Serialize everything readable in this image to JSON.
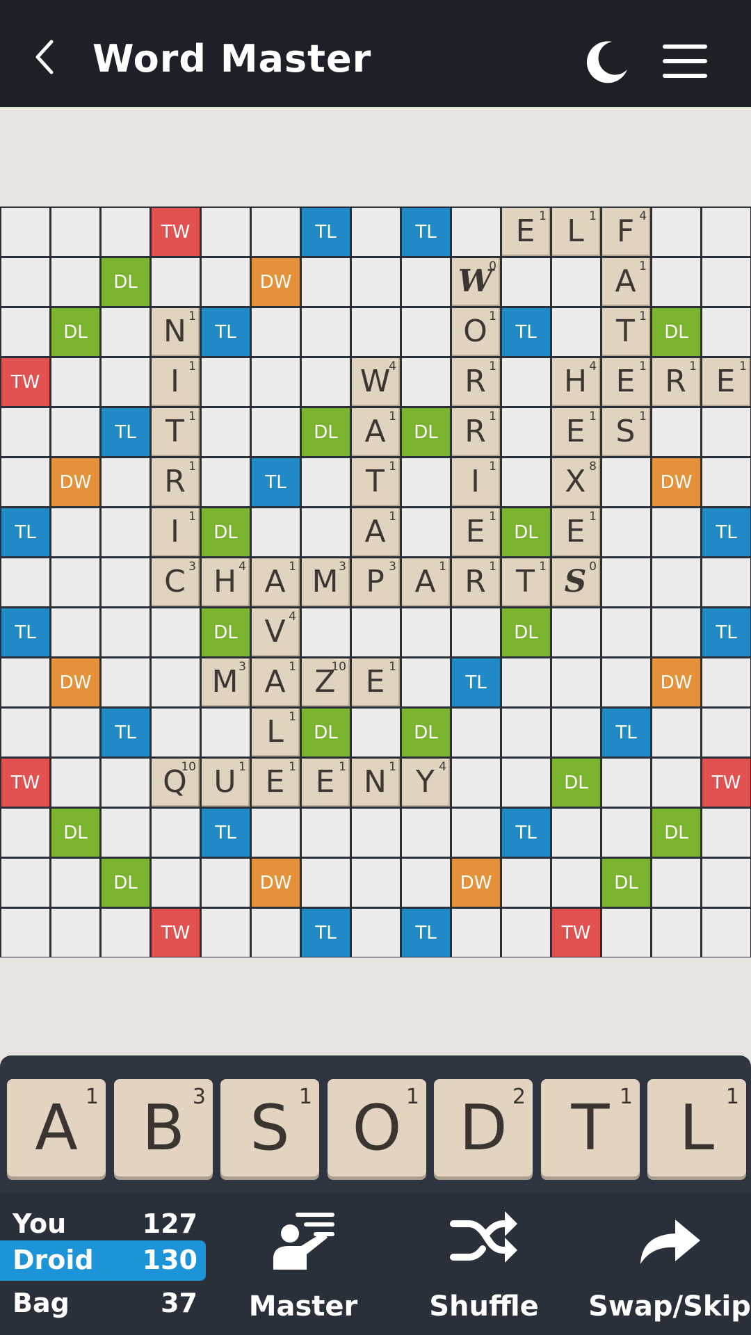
{
  "app": {
    "title": "Word Master"
  },
  "colors": {
    "tw": "#e0514f",
    "dw": "#e4923a",
    "dl": "#7ab32e",
    "tl": "#1f8ac6",
    "tile": "#e0d4c1",
    "active": "#1d93d8"
  },
  "icons": {
    "back": "chevron-left-icon",
    "theme": "moon-icon",
    "menu": "hamburger-menu-icon",
    "master": "master-icon",
    "shuffle": "shuffle-icon",
    "swap": "swap-arrow-icon"
  },
  "premium_labels": {
    "tw": "TW",
    "dw": "DW",
    "dl": "DL",
    "tl": "TL"
  },
  "board": {
    "rows": [
      "...T..t.t..EL F..",
      "..d..D...W...A..",
      ".d.N t....O t.Td.",
      "T..I...W.R.HERE",
      "..tT..dAdR.ES..",
      ".D.R.t.T.I.X..D.",
      "t..Id..A.Ed E..t",
      "...CHAMPARTS...",
      "t...dV....d...t",
      ".D..MAZE..t...D.",
      "..t..LdDd..t...",
      "T..QUEENY..d..T",
      ".d..t....t..d.",
      "..d..D...D..d..",
      "...T..t.t..T..."
    ],
    "premiums": [
      [
        "",
        "",
        "",
        "TW",
        "",
        "",
        "TL",
        "",
        "TL",
        "",
        "",
        "",
        "",
        "",
        ""
      ],
      [
        "",
        "",
        "DL",
        "",
        "",
        "DW",
        "",
        "",
        "",
        "",
        "",
        "",
        "",
        "",
        ""
      ],
      [
        "",
        "DL",
        "",
        "",
        "TL",
        "",
        "",
        "",
        "",
        "",
        "TL",
        "",
        "",
        "DL",
        ""
      ],
      [
        "TW",
        "",
        "",
        "",
        "",
        "",
        "",
        "",
        "",
        "",
        "",
        "",
        "",
        "",
        ""
      ],
      [
        "",
        "",
        "TL",
        "",
        "",
        "",
        "DL",
        "",
        "DL",
        "",
        "",
        "",
        "",
        "",
        ""
      ],
      [
        "",
        "DW",
        "",
        "",
        "",
        "TL",
        "",
        "",
        "",
        "",
        "",
        "",
        "",
        "DW",
        ""
      ],
      [
        "TL",
        "",
        "",
        "",
        "DL",
        "",
        "",
        "",
        "",
        "",
        "DL",
        "",
        "",
        "",
        "TL"
      ],
      [
        "",
        "",
        "",
        "",
        "",
        "",
        "",
        "",
        "",
        "",
        "",
        "",
        "",
        "",
        ""
      ],
      [
        "TL",
        "",
        "",
        "",
        "DL",
        "",
        "",
        "",
        "",
        "",
        "DL",
        "",
        "",
        "",
        "TL"
      ],
      [
        "",
        "DW",
        "",
        "",
        "",
        "",
        "",
        "",
        "",
        "TL",
        "",
        "",
        "",
        "DW",
        ""
      ],
      [
        "",
        "",
        "TL",
        "",
        "",
        "",
        "DL",
        "",
        "DL",
        "",
        "",
        "",
        "TL",
        "",
        ""
      ],
      [
        "TW",
        "",
        "",
        "",
        "",
        "",
        "",
        "",
        "",
        "",
        "",
        "DL",
        "",
        "",
        "TW"
      ],
      [
        "",
        "DL",
        "",
        "",
        "TL",
        "",
        "",
        "",
        "",
        "",
        "TL",
        "",
        "",
        "DL",
        ""
      ],
      [
        "",
        "",
        "DL",
        "",
        "",
        "DW",
        "",
        "",
        "",
        "DW",
        "",
        "",
        "DL",
        "",
        ""
      ],
      [
        "",
        "",
        "",
        "TW",
        "",
        "",
        "TL",
        "",
        "TL",
        "",
        "",
        "TW",
        "",
        "",
        ""
      ]
    ],
    "tiles": [
      {
        "r": 0,
        "c": 10,
        "letter": "E",
        "pts": "1"
      },
      {
        "r": 0,
        "c": 11,
        "letter": "L",
        "pts": "1"
      },
      {
        "r": 0,
        "c": 12,
        "letter": "F",
        "pts": "4"
      },
      {
        "r": 1,
        "c": 9,
        "letter": "W",
        "pts": "0",
        "blank": true
      },
      {
        "r": 1,
        "c": 12,
        "letter": "A",
        "pts": "1"
      },
      {
        "r": 2,
        "c": 3,
        "letter": "N",
        "pts": "1"
      },
      {
        "r": 2,
        "c": 9,
        "letter": "O",
        "pts": "1"
      },
      {
        "r": 2,
        "c": 12,
        "letter": "T",
        "pts": "1"
      },
      {
        "r": 3,
        "c": 3,
        "letter": "I",
        "pts": "1"
      },
      {
        "r": 3,
        "c": 7,
        "letter": "W",
        "pts": "4"
      },
      {
        "r": 3,
        "c": 9,
        "letter": "R",
        "pts": "1"
      },
      {
        "r": 3,
        "c": 11,
        "letter": "H",
        "pts": "4"
      },
      {
        "r": 3,
        "c": 12,
        "letter": "E",
        "pts": "1"
      },
      {
        "r": 3,
        "c": 13,
        "letter": "R",
        "pts": "1"
      },
      {
        "r": 3,
        "c": 14,
        "letter": "E",
        "pts": "1"
      },
      {
        "r": 4,
        "c": 3,
        "letter": "T",
        "pts": "1"
      },
      {
        "r": 4,
        "c": 7,
        "letter": "A",
        "pts": "1"
      },
      {
        "r": 4,
        "c": 9,
        "letter": "R",
        "pts": "1"
      },
      {
        "r": 4,
        "c": 11,
        "letter": "E",
        "pts": "1"
      },
      {
        "r": 4,
        "c": 12,
        "letter": "S",
        "pts": "1"
      },
      {
        "r": 5,
        "c": 3,
        "letter": "R",
        "pts": "1"
      },
      {
        "r": 5,
        "c": 7,
        "letter": "T",
        "pts": "1"
      },
      {
        "r": 5,
        "c": 9,
        "letter": "I",
        "pts": "1"
      },
      {
        "r": 5,
        "c": 11,
        "letter": "X",
        "pts": "8"
      },
      {
        "r": 6,
        "c": 3,
        "letter": "I",
        "pts": "1"
      },
      {
        "r": 6,
        "c": 7,
        "letter": "A",
        "pts": "1"
      },
      {
        "r": 6,
        "c": 9,
        "letter": "E",
        "pts": "1"
      },
      {
        "r": 6,
        "c": 11,
        "letter": "E",
        "pts": "1"
      },
      {
        "r": 7,
        "c": 3,
        "letter": "C",
        "pts": "3"
      },
      {
        "r": 7,
        "c": 4,
        "letter": "H",
        "pts": "4"
      },
      {
        "r": 7,
        "c": 5,
        "letter": "A",
        "pts": "1"
      },
      {
        "r": 7,
        "c": 6,
        "letter": "M",
        "pts": "3"
      },
      {
        "r": 7,
        "c": 7,
        "letter": "P",
        "pts": "3"
      },
      {
        "r": 7,
        "c": 8,
        "letter": "A",
        "pts": "1"
      },
      {
        "r": 7,
        "c": 9,
        "letter": "R",
        "pts": "1"
      },
      {
        "r": 7,
        "c": 10,
        "letter": "T",
        "pts": "1"
      },
      {
        "r": 7,
        "c": 11,
        "letter": "S",
        "pts": "0",
        "blank": true
      },
      {
        "r": 8,
        "c": 5,
        "letter": "V",
        "pts": "4"
      },
      {
        "r": 9,
        "c": 4,
        "letter": "M",
        "pts": "3"
      },
      {
        "r": 9,
        "c": 5,
        "letter": "A",
        "pts": "1"
      },
      {
        "r": 9,
        "c": 6,
        "letter": "Z",
        "pts": "10"
      },
      {
        "r": 9,
        "c": 7,
        "letter": "E",
        "pts": "1"
      },
      {
        "r": 10,
        "c": 5,
        "letter": "L",
        "pts": "1"
      },
      {
        "r": 11,
        "c": 3,
        "letter": "Q",
        "pts": "10"
      },
      {
        "r": 11,
        "c": 4,
        "letter": "U",
        "pts": "1"
      },
      {
        "r": 11,
        "c": 5,
        "letter": "E",
        "pts": "1"
      },
      {
        "r": 11,
        "c": 6,
        "letter": "E",
        "pts": "1"
      },
      {
        "r": 11,
        "c": 7,
        "letter": "N",
        "pts": "1"
      },
      {
        "r": 11,
        "c": 8,
        "letter": "Y",
        "pts": "4"
      }
    ]
  },
  "rack": [
    {
      "letter": "A",
      "pts": "1"
    },
    {
      "letter": "B",
      "pts": "3"
    },
    {
      "letter": "S",
      "pts": "1"
    },
    {
      "letter": "O",
      "pts": "1"
    },
    {
      "letter": "D",
      "pts": "2"
    },
    {
      "letter": "T",
      "pts": "1"
    },
    {
      "letter": "L",
      "pts": "1"
    }
  ],
  "scores": {
    "you": {
      "label": "You",
      "value": "127"
    },
    "droid": {
      "label": "Droid",
      "value": "130"
    },
    "bag": {
      "label": "Bag",
      "value": "37"
    }
  },
  "actions": {
    "master": "Master",
    "shuffle": "Shuffle",
    "swap": "Swap/Skip"
  }
}
